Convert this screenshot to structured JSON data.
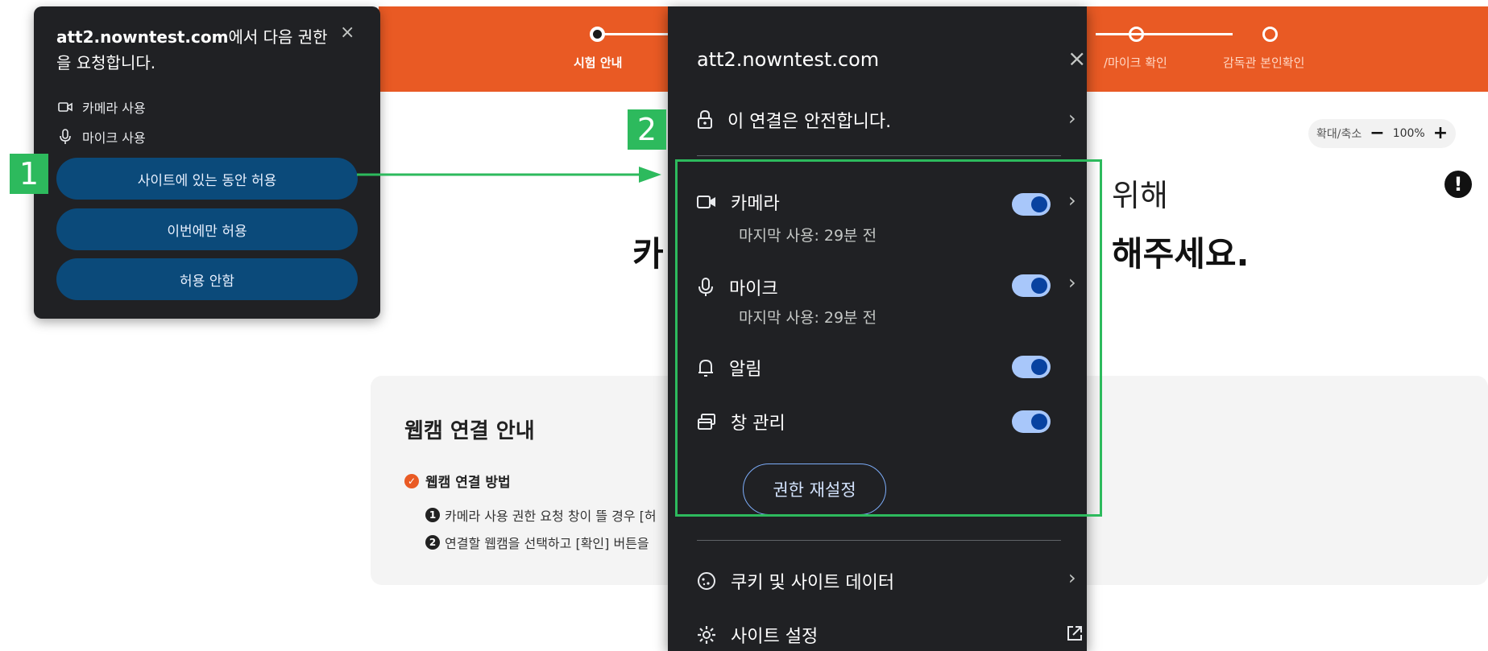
{
  "stepper": {
    "steps": [
      {
        "label": "시험 안내",
        "state": "active"
      },
      {
        "label": "카메라/마이크 확인",
        "visible_text": "/마이크 확인",
        "state": "pending"
      },
      {
        "label": "감독관 본인확인",
        "state": "pending"
      }
    ]
  },
  "zoom": {
    "label": "확대/축소",
    "minus": "−",
    "value": "100%",
    "plus": "+"
  },
  "page": {
    "hero_line1_partial": "위해",
    "hero_line2_left_partial": "카",
    "hero_line2_right_partial": "해주세요."
  },
  "guide": {
    "title": "웹캠 연결 안내",
    "subtitle": "웹캠 연결 방법",
    "line1_num": "1",
    "line1": "카메라 사용 권한 요청 창이 뜰 경우 [허",
    "line2_num": "2",
    "line2": "연결할 웹캠을 선택하고 [확인] 버튼을"
  },
  "popup1": {
    "domain": "att2.nowntest.com",
    "title_rest": "에서 다음 권한을 요청합니다.",
    "close": "×",
    "perm_camera": "카메라 사용",
    "perm_mic": "마이크 사용",
    "btn_allow_while": "사이트에 있는 동안 허용",
    "btn_allow_once": "이번에만 허용",
    "btn_deny": "허용 안함"
  },
  "popup2": {
    "host": "att2.nowntest.com",
    "close": "×",
    "secure": "이 연결은 안전합니다.",
    "camera": {
      "label": "카메라",
      "sub": "마지막 사용: 29분 전",
      "enabled": true
    },
    "mic": {
      "label": "마이크",
      "sub": "마지막 사용: 29분 전",
      "enabled": true
    },
    "notifications": {
      "label": "알림",
      "enabled": true
    },
    "window_mgmt": {
      "label": "창 관리",
      "enabled": true
    },
    "reset": "권한 재설정",
    "cookies": "쿠키 및 사이트 데이터",
    "site_settings": "사이트 설정"
  },
  "annotations": {
    "badge1": "1",
    "badge2": "2",
    "accent": "#2dba5d"
  },
  "colors": {
    "brand_orange": "#e95a24",
    "popup_bg": "#202124",
    "btn_blue": "#0b4a7a"
  }
}
